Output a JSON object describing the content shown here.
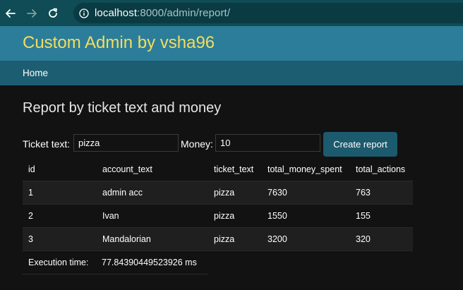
{
  "browser": {
    "url_host": "localhost",
    "url_rest": ":8000/admin/report/"
  },
  "header": {
    "site_title": "Custom Admin by vsha96"
  },
  "breadcrumb": {
    "home": "Home"
  },
  "page": {
    "heading": "Report by ticket text and money"
  },
  "form": {
    "ticket_label": "Ticket text:",
    "ticket_value": "pizza",
    "money_label": "Money:",
    "money_value": "10",
    "submit_label": "Create report"
  },
  "table": {
    "columns": [
      "id",
      "account_text",
      "ticket_text",
      "total_money_spent",
      "total_actions"
    ],
    "rows": [
      [
        "1",
        "admin acc",
        "pizza",
        "7630",
        "763"
      ],
      [
        "2",
        "Ivan",
        "pizza",
        "1550",
        "155"
      ],
      [
        "3",
        "Mandalorian",
        "pizza",
        "3200",
        "320"
      ]
    ]
  },
  "execution": {
    "label": "Execution time:",
    "value": "77.84390449523926 ms"
  },
  "colors": {
    "toolbar": "#0f4c55",
    "header": "#2c7d99",
    "title": "#f5dd5d",
    "breadcrumb_bar": "#1d5d71",
    "background": "#121212",
    "button": "#1c5a6e"
  }
}
